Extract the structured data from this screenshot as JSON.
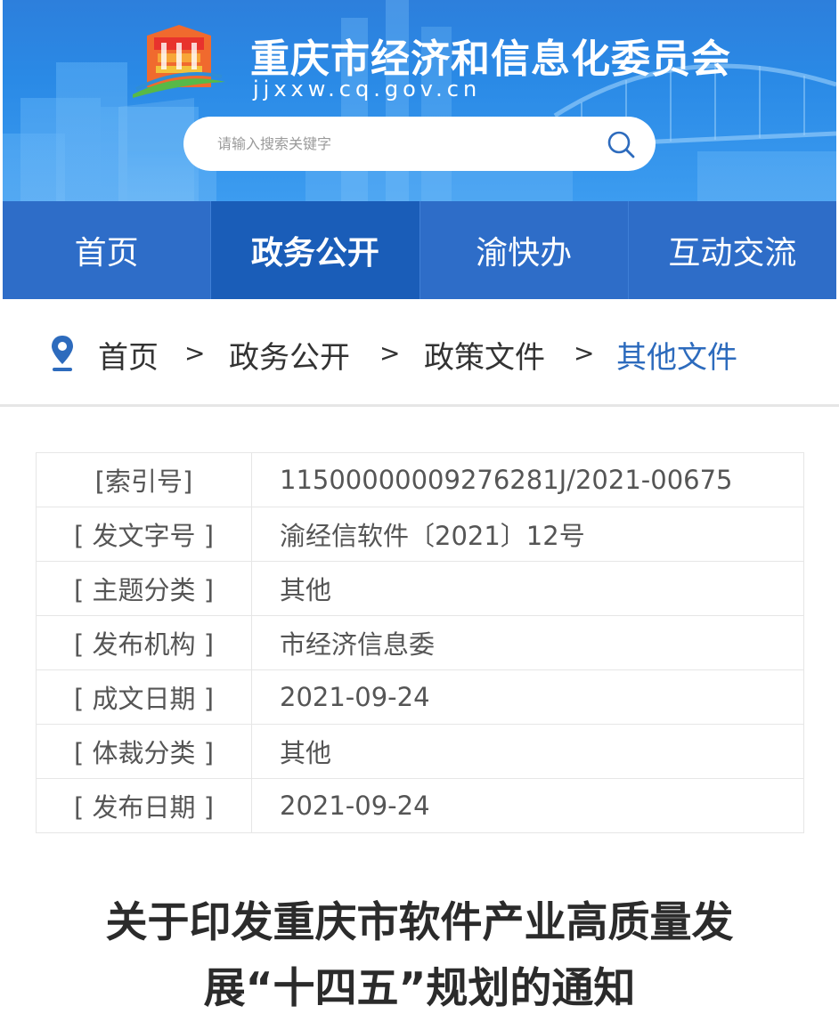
{
  "header": {
    "site_title": "重庆市经济和信息化委员会",
    "site_domain": "jjxxw.cq.gov.cn",
    "search": {
      "placeholder": "请输入搜索关键字"
    }
  },
  "nav": {
    "items": [
      {
        "label": "首页",
        "active": false
      },
      {
        "label": "政务公开",
        "active": true
      },
      {
        "label": "渝快办",
        "active": false
      },
      {
        "label": "互动交流",
        "active": false
      }
    ]
  },
  "breadcrumb": {
    "items": [
      "首页",
      "政务公开",
      "政策文件",
      "其他文件"
    ],
    "separator": ">"
  },
  "info_table": {
    "rows": [
      {
        "label": "[索引号]",
        "value": "11500000009276281J/2021-00675"
      },
      {
        "label": "[ 发文字号 ]",
        "value": "渝经信软件〔2021〕12号"
      },
      {
        "label": "[ 主题分类 ]",
        "value": "其他"
      },
      {
        "label": "[ 发布机构 ]",
        "value": "市经济信息委"
      },
      {
        "label": "[ 成文日期 ]",
        "value": "2021-09-24"
      },
      {
        "label": "[ 体裁分类 ]",
        "value": "其他"
      },
      {
        "label": "[ 发布日期 ]",
        "value": "2021-09-24"
      }
    ]
  },
  "article": {
    "title": "关于印发重庆市软件产业高质量发展“十四五”规划的通知"
  },
  "colors": {
    "nav_bg": "#2e6dc8",
    "nav_active_bg": "#1a5db8",
    "breadcrumb_current": "#2d6bbd",
    "banner_bg": "#2a8ae6"
  },
  "icons": {
    "search": "search-icon",
    "location": "location-pin-icon",
    "logo": "site-logo"
  }
}
